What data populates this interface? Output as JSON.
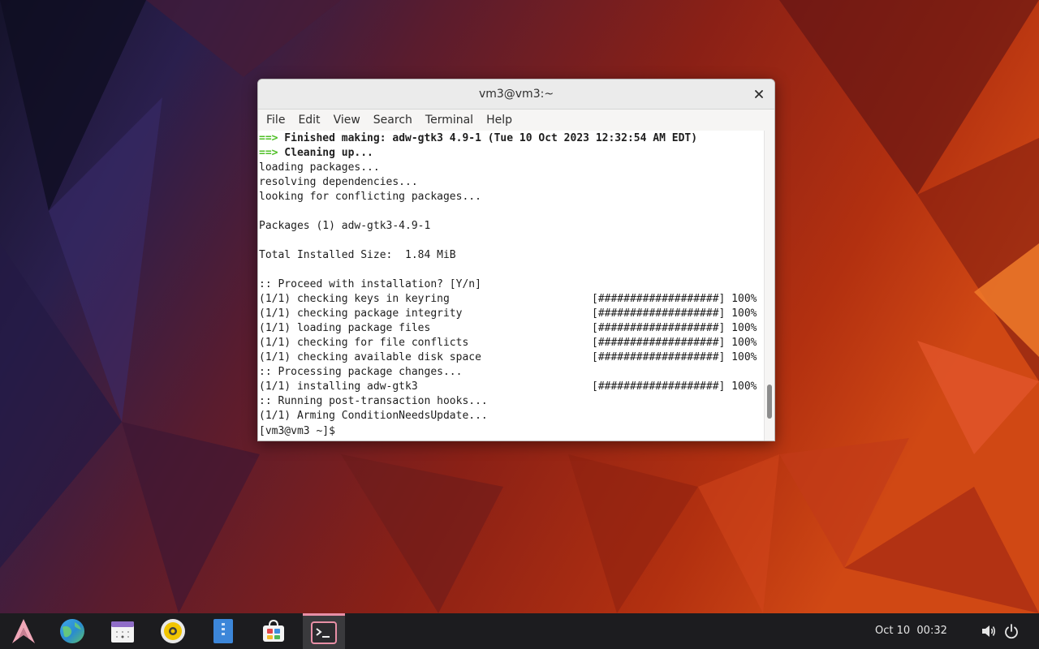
{
  "window": {
    "title": "vm3@vm3:~",
    "close_glyph": "✕",
    "menu": [
      "File",
      "Edit",
      "View",
      "Search",
      "Terminal",
      "Help"
    ]
  },
  "terminal": {
    "lines": [
      {
        "arrow": "==>",
        "text": " Finished making: adw-gtk3 4.9-1 (Tue 10 Oct 2023 12:32:54 AM EDT)",
        "bold": true
      },
      {
        "arrow": "==>",
        "text": " Cleaning up...",
        "bold": true
      },
      {
        "text": "loading packages..."
      },
      {
        "text": "resolving dependencies..."
      },
      {
        "text": "looking for conflicting packages..."
      },
      {
        "text": ""
      },
      {
        "text": "Packages (1) adw-gtk3-4.9-1"
      },
      {
        "text": ""
      },
      {
        "text": "Total Installed Size:  1.84 MiB"
      },
      {
        "text": ""
      },
      {
        "text": ":: Proceed with installation? [Y/n]"
      },
      {
        "text": "(1/1) checking keys in keyring",
        "progress": "[###################] 100%"
      },
      {
        "text": "(1/1) checking package integrity",
        "progress": "[###################] 100%"
      },
      {
        "text": "(1/1) loading package files",
        "progress": "[###################] 100%"
      },
      {
        "text": "(1/1) checking for file conflicts",
        "progress": "[###################] 100%"
      },
      {
        "text": "(1/1) checking available disk space",
        "progress": "[###################] 100%"
      },
      {
        "text": ":: Processing package changes..."
      },
      {
        "text": "(1/1) installing adw-gtk3",
        "progress": "[###################] 100%"
      },
      {
        "text": ":: Running post-transaction hooks..."
      },
      {
        "text": "(1/1) Arming ConditionNeedsUpdate..."
      },
      {
        "text": "[vm3@vm3 ~]$ ",
        "prompt": true
      }
    ],
    "scroll_position": 0.92,
    "scroll_visible_fraction": 0.11
  },
  "taskbar": {
    "apps": [
      {
        "name": "arch-logo-icon",
        "active": false
      },
      {
        "name": "web-browser-icon",
        "active": false
      },
      {
        "name": "calendar-icon",
        "active": false
      },
      {
        "name": "music-player-icon",
        "active": false
      },
      {
        "name": "file-manager-icon",
        "active": false
      },
      {
        "name": "software-store-icon",
        "active": false
      },
      {
        "name": "terminal-icon",
        "active": true
      }
    ],
    "clock": "Oct 10  00:32",
    "tray": [
      "volume-icon",
      "power-icon"
    ]
  },
  "colors": {
    "arrow_green": "#4fbf26",
    "taskbar_bg": "#1c1c1f",
    "active_indicator": "#e88fa6"
  }
}
